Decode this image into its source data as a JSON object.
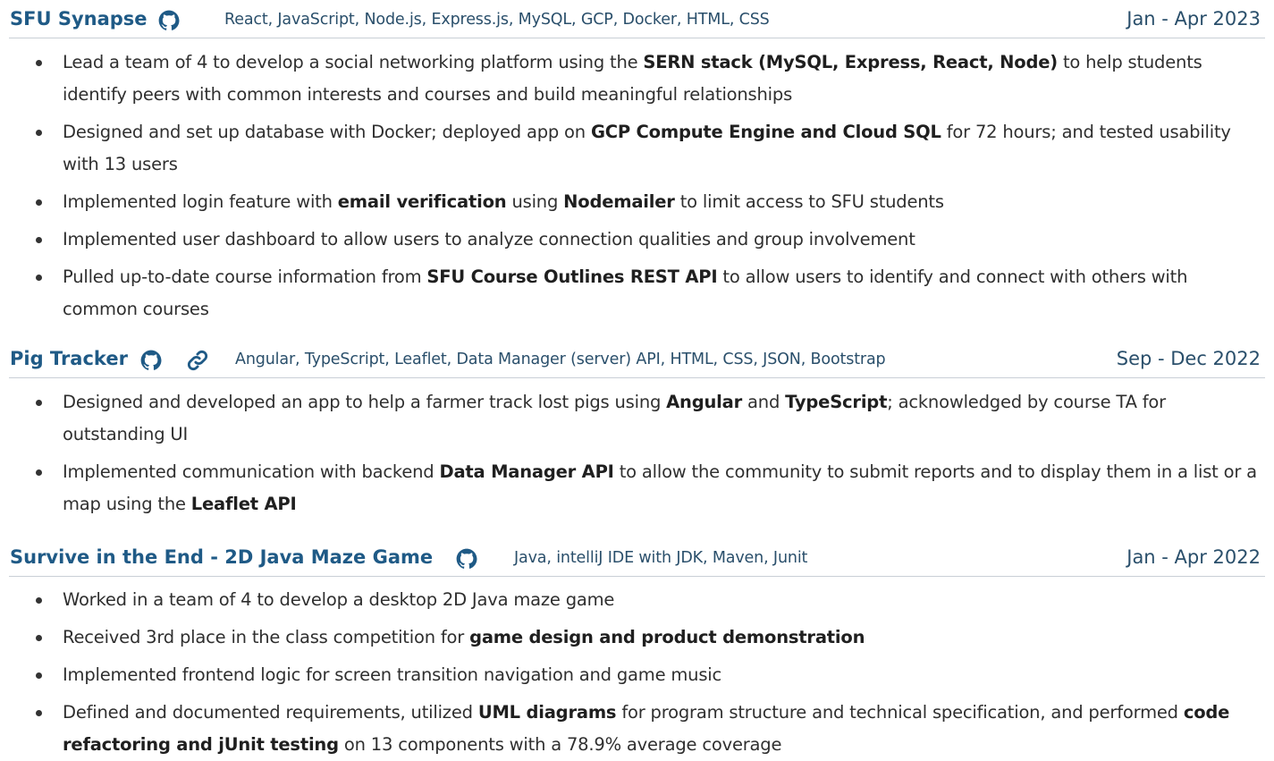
{
  "projects": [
    {
      "title": "SFU Synapse",
      "tech": "React, JavaScript, Node.js, Express.js, MySQL, GCP, Docker, HTML, CSS",
      "date": "Jan - Apr 2023",
      "icons": [
        "github-icon"
      ],
      "bullets": [
        [
          {
            "t": "Lead a team of 4 to develop a social networking platform using the "
          },
          {
            "t": "SERN stack (MySQL, Express, React, Node)",
            "b": true
          },
          {
            "t": " to help students identify peers with common interests and courses and build meaningful relationships"
          }
        ],
        [
          {
            "t": "Designed and set up database with Docker; deployed app on "
          },
          {
            "t": "GCP Compute Engine and Cloud SQL",
            "b": true
          },
          {
            "t": " for 72 hours; and tested usability with 13 users"
          }
        ],
        [
          {
            "t": "Implemented login feature with "
          },
          {
            "t": "email verification",
            "b": true
          },
          {
            "t": " using "
          },
          {
            "t": "Nodemailer",
            "b": true
          },
          {
            "t": " to limit access to SFU students"
          }
        ],
        [
          {
            "t": "Implemented user dashboard to allow users to analyze connection qualities and group involvement"
          }
        ],
        [
          {
            "t": "Pulled up-to-date course information from "
          },
          {
            "t": "SFU Course Outlines REST API",
            "b": true
          },
          {
            "t": " to allow users to identify and connect with others with common courses"
          }
        ]
      ]
    },
    {
      "title": "Pig Tracker",
      "tech": "Angular, TypeScript, Leaflet, Data Manager (server) API, HTML, CSS,  JSON, Bootstrap",
      "date": "Sep - Dec 2022",
      "icons": [
        "github-icon",
        "link-icon"
      ],
      "bullets": [
        [
          {
            "t": "Designed and developed an app to help a farmer track lost pigs using "
          },
          {
            "t": "Angular",
            "b": true
          },
          {
            "t": " and "
          },
          {
            "t": "TypeScript",
            "b": true
          },
          {
            "t": "; acknowledged by course TA for outstanding UI"
          }
        ],
        [
          {
            "t": "Implemented communication with backend "
          },
          {
            "t": "Data Manager API",
            "b": true
          },
          {
            "t": " to allow the community to submit reports and to display them in a list or a map using the "
          },
          {
            "t": "Leaflet API",
            "b": true
          }
        ]
      ]
    },
    {
      "title": "Survive in the End - 2D Java Maze Game",
      "tech": "Java, intelliJ IDE with JDK, Maven, Junit",
      "date": "Jan - Apr 2022",
      "icons": [
        "github-icon"
      ],
      "bullets": [
        [
          {
            "t": "Worked in a team of 4 to develop a desktop 2D Java maze game"
          }
        ],
        [
          {
            "t": "Received 3rd place in the class competition for "
          },
          {
            "t": "game design and product demonstration",
            "b": true
          }
        ],
        [
          {
            "t": "Implemented frontend logic for screen transition navigation and game music"
          }
        ],
        [
          {
            "t": "Defined and documented requirements, utilized "
          },
          {
            "t": "UML diagrams",
            "b": true
          },
          {
            "t": " for program structure and technical specification, and performed "
          },
          {
            "t": "code refactoring and jUnit testing",
            "b": true
          },
          {
            "t": " on 13 components with a 78.9% average coverage"
          }
        ]
      ]
    }
  ]
}
